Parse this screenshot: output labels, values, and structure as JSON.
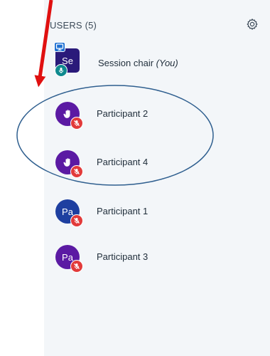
{
  "header": {
    "title": "USERS (5)"
  },
  "colors": {
    "chair_avatar": "#2a1a7a",
    "participant_raised": "#5b1aa3",
    "participant_blue": "#1e3fa0",
    "participant_purple": "#5b1aa3",
    "mic_muted": "#e23a3a",
    "mic_active": "#0f8a8f",
    "presenter_badge": "#1d6fd1",
    "annotation_red": "#e01010",
    "annotation_ellipse": "#2f5f8f"
  },
  "users": [
    {
      "initials": "Se",
      "name": "Session chair",
      "suffix": "(You)",
      "avatar_shape": "square",
      "status_icon": "mic-icon",
      "presenter": true
    },
    {
      "initials": "",
      "name": "Participant 2",
      "suffix": "",
      "avatar_shape": "round",
      "status_icon": "mic-muted-icon",
      "raised_hand": true
    },
    {
      "initials": "",
      "name": "Participant 4",
      "suffix": "",
      "avatar_shape": "round",
      "status_icon": "mic-muted-icon",
      "raised_hand": true
    },
    {
      "initials": "Pa",
      "name": "Participant 1",
      "suffix": "",
      "avatar_shape": "round",
      "status_icon": "mic-muted-icon"
    },
    {
      "initials": "Pa",
      "name": "Participant 3",
      "suffix": "",
      "avatar_shape": "round",
      "status_icon": "mic-muted-icon"
    }
  ]
}
